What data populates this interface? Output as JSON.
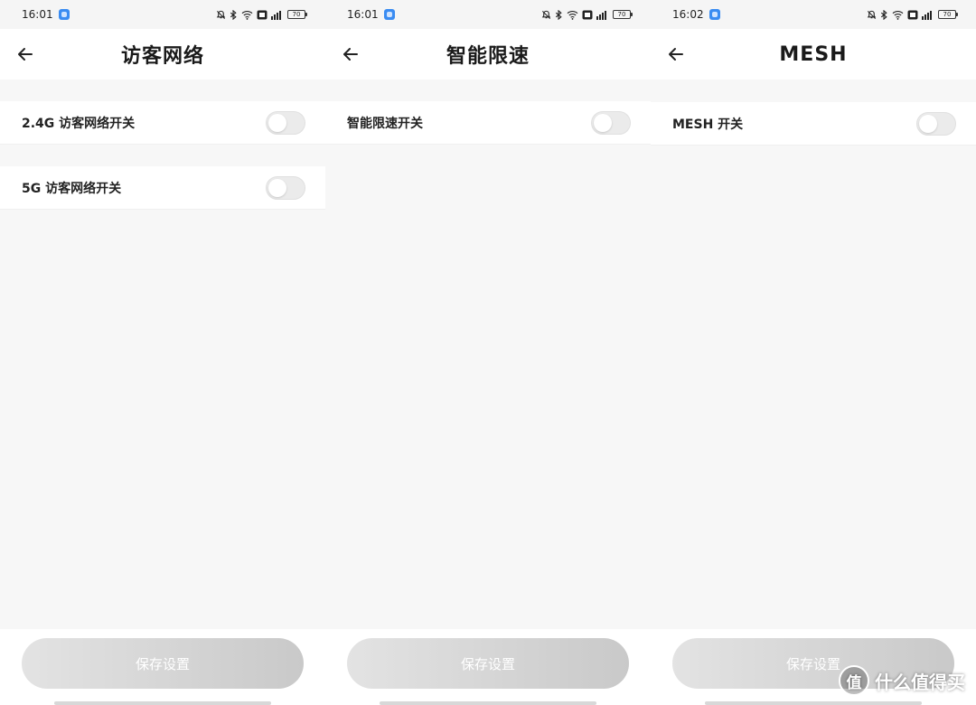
{
  "colors": {
    "background": "#f7f7f7",
    "surface": "#ffffff",
    "toggle_off": "#ebebeb",
    "save_button_disabled": "#d4d4d4",
    "status_app_icon": "#3a8cf2"
  },
  "panels": [
    {
      "status": {
        "time": "16:01",
        "battery": "70"
      },
      "header": {
        "back_icon": "arrow-left-icon",
        "title": "访客网络"
      },
      "rows": [
        {
          "label": "2.4G 访客网络开关",
          "on": false
        },
        {
          "label": "5G 访客网络开关",
          "on": false
        }
      ],
      "save_label": "保存设置"
    },
    {
      "status": {
        "time": "16:01",
        "battery": "70"
      },
      "header": {
        "back_icon": "arrow-left-icon",
        "title": "智能限速"
      },
      "rows": [
        {
          "label": "智能限速开关",
          "on": false
        }
      ],
      "save_label": "保存设置"
    },
    {
      "status": {
        "time": "16:02",
        "battery": "70"
      },
      "header": {
        "back_icon": "arrow-left-icon",
        "title": "MESH"
      },
      "rows": [
        {
          "label": "MESH 开关",
          "on": false
        }
      ],
      "save_label": "保存设置"
    }
  ],
  "watermark": {
    "logo": "值",
    "text": "什么值得买"
  }
}
